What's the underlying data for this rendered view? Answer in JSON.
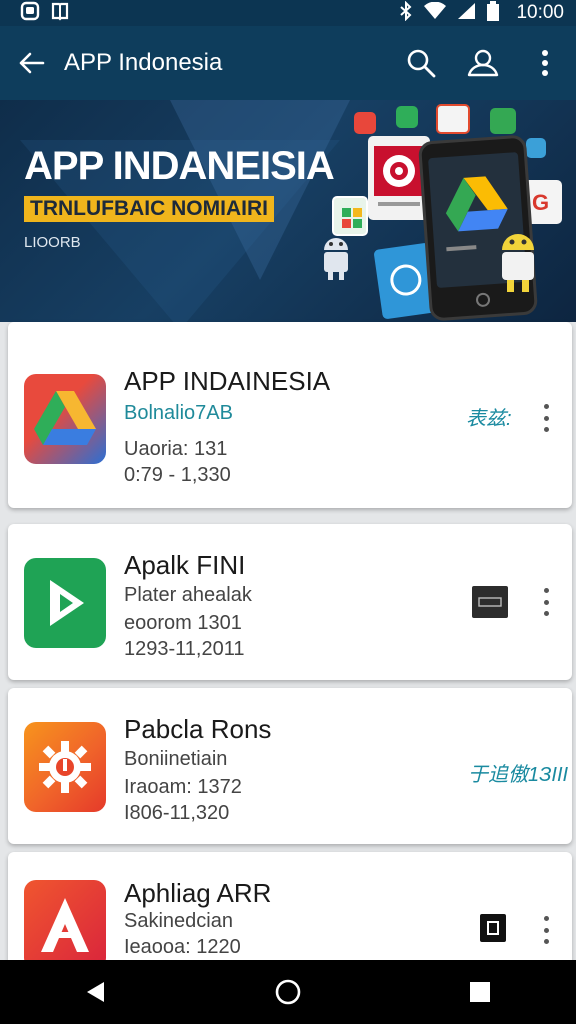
{
  "status": {
    "time": "10:00"
  },
  "appbar": {
    "title": "APP Indonesia"
  },
  "banner": {
    "title": "APP INDANEISIA",
    "ribbon": "TRNLUFBAIC NOMIAIRI",
    "subtitle": "LIOORB"
  },
  "cards": [
    {
      "name": "APP INDAINESIA",
      "line1": "Bolnalio7AB",
      "line2": "Uaoria: 131",
      "line3": "0:79 - 1,330",
      "tag": "表兹:",
      "icon": "drive-like-icon",
      "accent": "#1f8a9a"
    },
    {
      "name": "Apalk FINI",
      "line1": "Plater ahealak",
      "line2": "eoorom 1301",
      "line3": "1293-11,2011",
      "icon": "play-icon"
    },
    {
      "name": "Pabcla Rons",
      "line1": "Boniinetiain",
      "line2": "Iraoam: 1372",
      "line3": "I806-11,320",
      "tag": "于追傲1ЗIII",
      "icon": "gear-icon"
    },
    {
      "name": "Aphliag ARR",
      "line1": "Sakinedcian",
      "line2": "Ieaooa: 1220",
      "icon": "a-letter-icon"
    }
  ],
  "colors": {
    "statusbar": "#0c3552",
    "appbar": "#0e3d5c",
    "ribbon": "#f0b51c",
    "accent_teal": "#1a8aa0"
  }
}
